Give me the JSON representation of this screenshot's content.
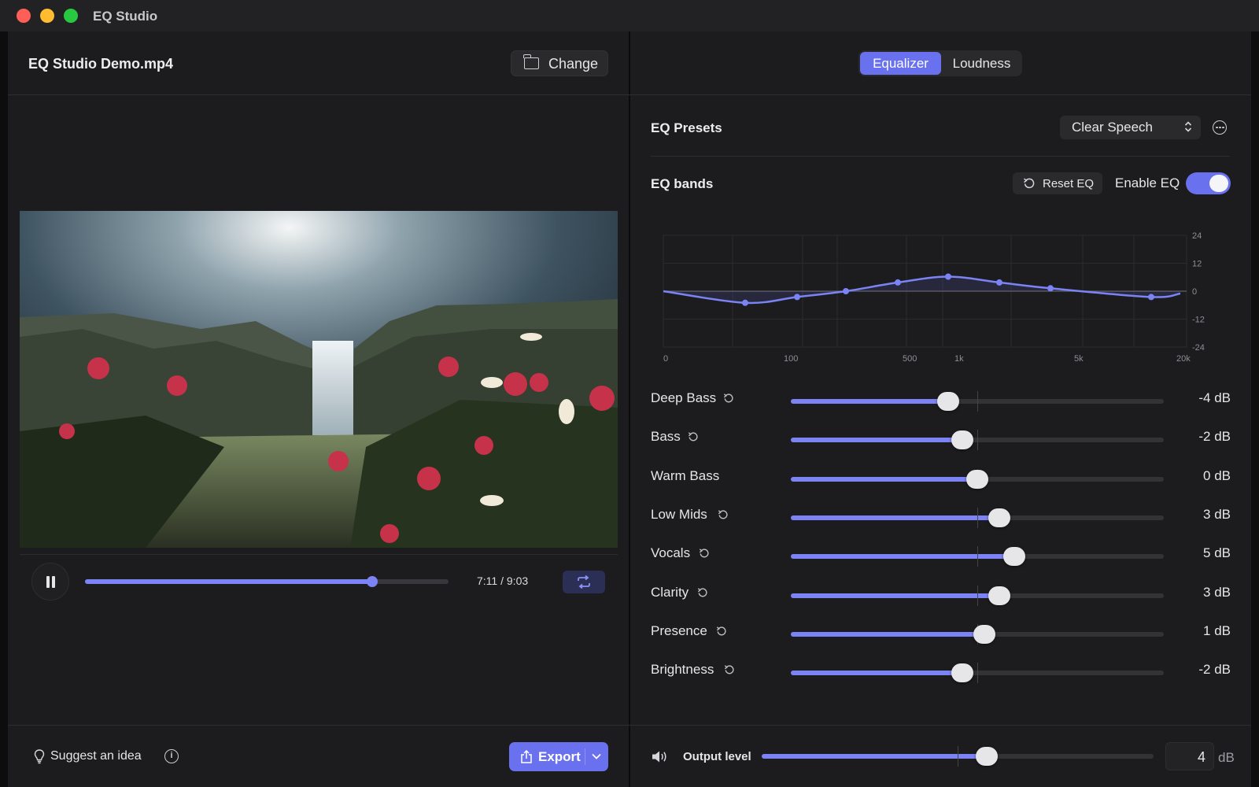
{
  "window": {
    "app_title": "EQ Studio"
  },
  "left": {
    "file_name": "EQ Studio Demo.mp4",
    "change_label": "Change",
    "player": {
      "progress": 0.79,
      "time_current": "7:11",
      "time_sep": "/",
      "time_total": "9:03"
    },
    "suggest_label": "Suggest an idea",
    "info_icon_glyph": "i",
    "export_label": "Export"
  },
  "right": {
    "tabs": {
      "equalizer": "Equalizer",
      "loudness": "Loudness",
      "active": "equalizer"
    },
    "presets": {
      "title": "EQ Presets",
      "selected": "Clear Speech"
    },
    "bands_section": {
      "title": "EQ bands",
      "reset_label": "Reset EQ",
      "enable_label": "Enable EQ",
      "enabled": true
    },
    "graph": {
      "x_ticks": [
        "0",
        "100",
        "500",
        "1k",
        "5k",
        "20k"
      ],
      "y_ticks": [
        "24",
        "12",
        "0",
        "-12",
        "-24"
      ]
    },
    "bands": [
      {
        "name": "Deep Bass",
        "value": -4,
        "value_label": "-4 dB",
        "resettable": true
      },
      {
        "name": "Bass",
        "value": -2,
        "value_label": "-2 dB",
        "resettable": true
      },
      {
        "name": "Warm Bass",
        "value": 0,
        "value_label": "0 dB",
        "resettable": false
      },
      {
        "name": "Low Mids",
        "value": 3,
        "value_label": "3 dB",
        "resettable": true
      },
      {
        "name": "Vocals",
        "value": 5,
        "value_label": "5 dB",
        "resettable": true
      },
      {
        "name": "Clarity",
        "value": 3,
        "value_label": "3 dB",
        "resettable": true
      },
      {
        "name": "Presence",
        "value": 1,
        "value_label": "1 dB",
        "resettable": true
      },
      {
        "name": "Brightness",
        "value": -2,
        "value_label": "-2 dB",
        "resettable": true
      }
    ],
    "output": {
      "label": "Output level",
      "value": "4",
      "unit": "dB",
      "level": 4
    }
  },
  "colors": {
    "accent": "#6971ee",
    "accent_light": "#7b83f5",
    "background": "#1c1c1e"
  },
  "icons": [
    "folder-icon",
    "pause-icon",
    "loop-icon",
    "lightbulb-icon",
    "info-icon",
    "export-icon",
    "chevron-down-icon",
    "updown-chevron-icon",
    "more-icon",
    "reset-icon",
    "speaker-icon"
  ]
}
